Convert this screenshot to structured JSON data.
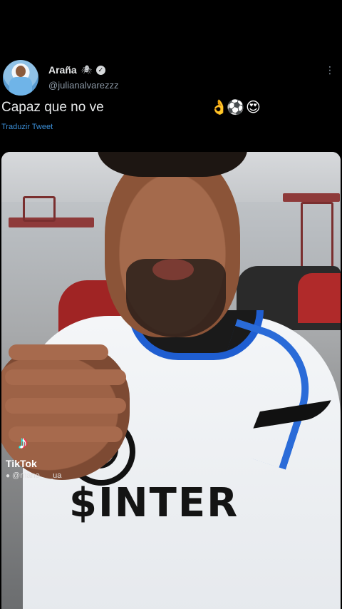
{
  "tweet": {
    "display_name": "Araña",
    "name_emoji": "🕷",
    "verified_mark": "✓",
    "handle": "@julianalvarezzz",
    "text": "Capaz que no ve",
    "emojis": [
      "👌",
      "⚽",
      "😍"
    ],
    "translate_label": "Traduzir Tweet",
    "more_icon": "⋮"
  },
  "video": {
    "jersey_text": "$INTER",
    "tiktok": {
      "logo": "♪",
      "label": "TikTok",
      "handle": "@mano___ua"
    }
  },
  "colors": {
    "background": "#000000",
    "link": "#3b8fd8",
    "handle": "#8b98a5",
    "jersey_blue": "#1f5ed1"
  }
}
